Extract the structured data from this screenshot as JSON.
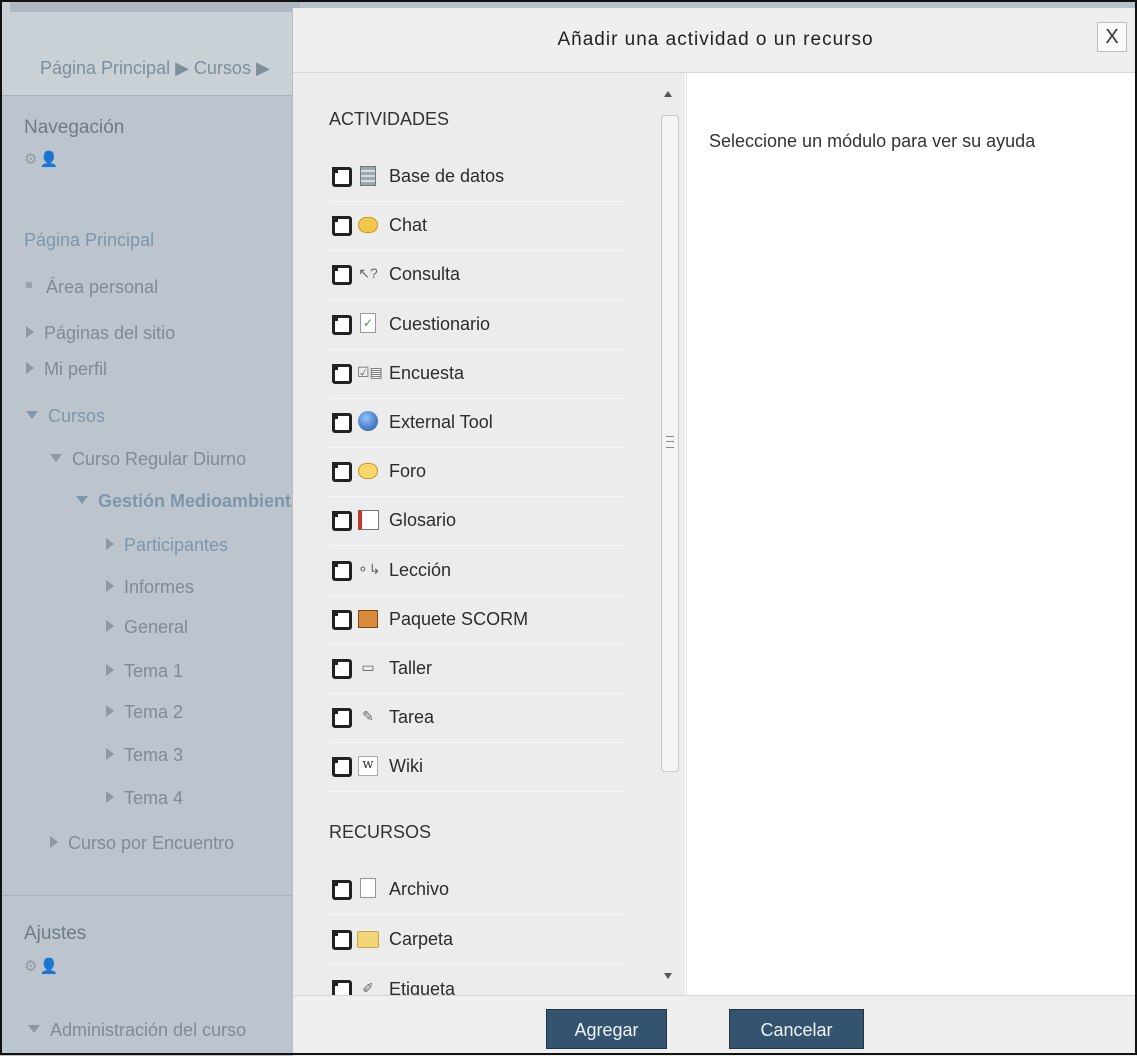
{
  "background": {
    "breadcrumb": "Página Principal ▶ Cursos ▶",
    "navigation": {
      "title": "Navegación",
      "items": [
        {
          "label": "Página Principal",
          "kind": "link",
          "indent": 0
        },
        {
          "label": "Área personal",
          "kind": "bullet",
          "indent": 1
        },
        {
          "label": "Páginas del sitio",
          "kind": "collapsed",
          "indent": 1
        },
        {
          "label": "Mi perfil",
          "kind": "collapsed",
          "indent": 1
        },
        {
          "label": "Cursos",
          "kind": "expanded-link",
          "indent": 1
        },
        {
          "label": "Curso Regular Diurno",
          "kind": "expanded",
          "indent": 2
        },
        {
          "label": "Gestión Medioambiental",
          "kind": "expanded-bold",
          "indent": 3
        },
        {
          "label": "Participantes",
          "kind": "collapsed-link",
          "indent": 4
        },
        {
          "label": "Informes",
          "kind": "collapsed",
          "indent": 4
        },
        {
          "label": "General",
          "kind": "collapsed",
          "indent": 4
        },
        {
          "label": "Tema 1",
          "kind": "collapsed",
          "indent": 4
        },
        {
          "label": "Tema 2",
          "kind": "collapsed",
          "indent": 4
        },
        {
          "label": "Tema 3",
          "kind": "collapsed",
          "indent": 4
        },
        {
          "label": "Tema 4",
          "kind": "collapsed",
          "indent": 4
        },
        {
          "label": "Curso por Encuentro",
          "kind": "collapsed",
          "indent": 2
        }
      ]
    },
    "settings": {
      "title": "Ajustes"
    },
    "admin_item": "Administración del curso"
  },
  "modal": {
    "title": "Añadir una actividad o un recurso",
    "close_label": "X",
    "activities": {
      "heading": "ACTIVIDADES",
      "items": [
        {
          "label": "Base de datos",
          "icon": "database-icon"
        },
        {
          "label": "Chat",
          "icon": "chat-icon"
        },
        {
          "label": "Consulta",
          "icon": "choice-icon"
        },
        {
          "label": "Cuestionario",
          "icon": "quiz-icon"
        },
        {
          "label": "Encuesta",
          "icon": "survey-icon"
        },
        {
          "label": "External Tool",
          "icon": "globe-icon"
        },
        {
          "label": "Foro",
          "icon": "forum-icon"
        },
        {
          "label": "Glosario",
          "icon": "glossary-icon"
        },
        {
          "label": "Lección",
          "icon": "lesson-icon"
        },
        {
          "label": "Paquete SCORM",
          "icon": "scorm-package-icon"
        },
        {
          "label": "Taller",
          "icon": "workshop-icon"
        },
        {
          "label": "Tarea",
          "icon": "assignment-icon"
        },
        {
          "label": "Wiki",
          "icon": "wiki-icon"
        }
      ]
    },
    "resources": {
      "heading": "RECURSOS",
      "items": [
        {
          "label": "Archivo",
          "icon": "file-icon"
        },
        {
          "label": "Carpeta",
          "icon": "folder-icon"
        },
        {
          "label": "Etiqueta",
          "icon": "label-icon"
        }
      ]
    },
    "help_text": "Seleccione un módulo para ver su ayuda",
    "buttons": {
      "add": "Agregar",
      "cancel": "Cancelar"
    }
  },
  "colors": {
    "overlay": "#bcc5cd",
    "button": "#33536f",
    "modal_bg": "#ffffff",
    "options_bg": "#ececec"
  }
}
